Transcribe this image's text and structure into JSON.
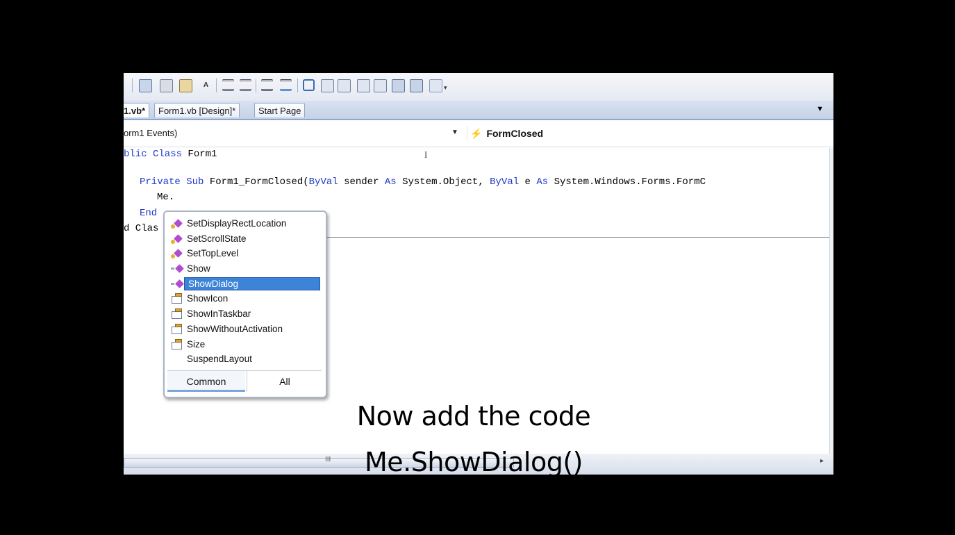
{
  "toolbar": {
    "icons": [
      "view-icon",
      "copy-icon",
      "paste-icon",
      "font-size-icon",
      "outdent-icon",
      "indent-icon",
      "comment-icon",
      "uncomment-icon",
      "box-icon",
      "bookmark-icon",
      "bookmark-prev-icon",
      "bookmark-next-icon",
      "bookmark-folder-icon",
      "bookmark-clear-icon",
      "find-icon",
      "more-icon"
    ]
  },
  "tabs": [
    {
      "label": "1.vb*",
      "active": true
    },
    {
      "label": "Form1.vb [Design]*",
      "active": false
    },
    {
      "label": "Start Page",
      "active": false
    }
  ],
  "navbar": {
    "class_combo": "orm1 Events)",
    "method_combo": "FormClosed"
  },
  "code": {
    "line1_kw": "blic Class",
    "line1_rest": " Form1",
    "line2_kw1": "Private Sub",
    "line2_mid1": " Form1_FormClosed(",
    "line2_kw2": "ByVal",
    "line2_mid2": " sender ",
    "line2_kw3": "As",
    "line2_mid3": " System.Object, ",
    "line2_kw4": "ByVal",
    "line2_mid4": " e ",
    "line2_kw5": "As",
    "line2_mid5": " System.Windows.Forms.FormC",
    "line3": "Me.",
    "line4_kw": "End",
    "line5": "d Clas"
  },
  "intellisense": {
    "items": [
      {
        "label": "SetDisplayRectLocation",
        "icon": "method-icon"
      },
      {
        "label": "SetScrollState",
        "icon": "method-icon"
      },
      {
        "label": "SetTopLevel",
        "icon": "method-icon"
      },
      {
        "label": "Show",
        "icon": "public-method-icon"
      },
      {
        "label": "ShowDialog",
        "icon": "public-method-icon",
        "selected": true
      },
      {
        "label": "ShowIcon",
        "icon": "property-icon"
      },
      {
        "label": "ShowInTaskbar",
        "icon": "property-icon"
      },
      {
        "label": "ShowWithoutActivation",
        "icon": "property-icon"
      },
      {
        "label": "Size",
        "icon": "property-icon"
      },
      {
        "label": "SuspendLayout",
        "icon": "none"
      }
    ],
    "tab_common": "Common",
    "tab_all": "All"
  },
  "hscroll": {
    "grip": "III"
  },
  "caption": {
    "line1": "Now add the code",
    "line2": "Me.ShowDialog()"
  },
  "colors": {
    "keyword": "#1f37c8",
    "selection": "#3d84d8"
  }
}
